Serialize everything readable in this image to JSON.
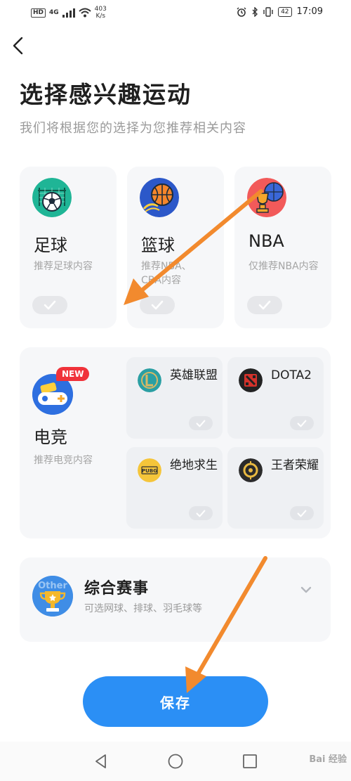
{
  "status_bar": {
    "left_badge": "HD",
    "network": "4G",
    "speed_value": "403",
    "speed_unit": "K/s",
    "battery": "42",
    "time": "17:09"
  },
  "header": {
    "title": "选择感兴趣运动",
    "subtitle": "我们将根据您的选择为您推荐相关内容"
  },
  "sports": [
    {
      "name": "足球",
      "desc": "推荐足球内容",
      "icon": "soccer-ball-icon"
    },
    {
      "name": "篮球",
      "desc": "推荐NBA、CBA内容",
      "icon": "basketball-icon"
    },
    {
      "name": "NBA",
      "desc": "仅推荐NBA内容",
      "icon": "nba-icon"
    }
  ],
  "esports": {
    "badge": "NEW",
    "name": "电竞",
    "desc": "推荐电竞内容",
    "games": [
      {
        "name": "英雄联盟",
        "icon": "lol-icon"
      },
      {
        "name": "DOTA2",
        "icon": "dota2-icon"
      },
      {
        "name": "绝地求生",
        "icon": "pubg-icon",
        "icon_text": "PUBG"
      },
      {
        "name": "王者荣耀",
        "icon": "honor-of-kings-icon"
      }
    ]
  },
  "combo": {
    "name": "综合赛事",
    "desc": "可选网球、排球、羽毛球等",
    "icon_text": "Other"
  },
  "save_label": "保存",
  "watermark": "Bai 经验",
  "colors": {
    "primary": "#2b8ff5",
    "card_bg": "#f6f7f9",
    "annotation_arrow": "#f28a2e",
    "new_badge": "#f0323a"
  }
}
